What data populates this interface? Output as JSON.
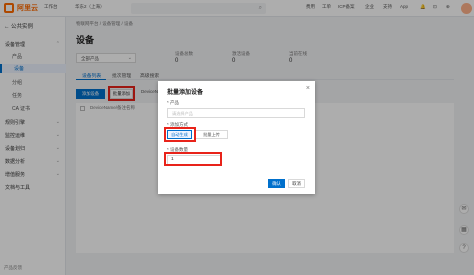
{
  "topbar": {
    "brand": "阿里云",
    "console": "工作台",
    "region": "华东2（上海）",
    "search_placeholder": "",
    "right_items": [
      "费用",
      "工单",
      "ICP备案",
      "企业",
      "支持",
      "App"
    ]
  },
  "sidebar": {
    "back_label": "公共实例",
    "items": [
      {
        "label": "设备管理",
        "level": "top"
      },
      {
        "label": "产品",
        "level": "sub"
      },
      {
        "label": "设备",
        "level": "sub",
        "active": true
      },
      {
        "label": "分组",
        "level": "sub"
      },
      {
        "label": "任务",
        "level": "sub"
      },
      {
        "label": "CA 证书",
        "level": "sub"
      },
      {
        "label": "规则引擎",
        "level": "top"
      },
      {
        "label": "监控运维",
        "level": "top"
      },
      {
        "label": "设备划归",
        "level": "top"
      },
      {
        "label": "数据分析",
        "level": "top"
      },
      {
        "label": "增值服务",
        "level": "top"
      },
      {
        "label": "文档与工具",
        "level": "top"
      }
    ],
    "bottom_label": "产品反馈"
  },
  "main": {
    "breadcrumb": "物联网平台  /  设备管理  /  设备",
    "title": "设备",
    "product_select": "全部产品",
    "stats": [
      {
        "label": "设备总数",
        "value": "0"
      },
      {
        "label": "激活设备",
        "value": "0"
      },
      {
        "label": "当前在线",
        "value": "0"
      }
    ],
    "tabs": [
      "设备列表",
      "批次管理",
      "高级搜索"
    ],
    "add_device_label": "添加设备",
    "batch_add_label": "批量添加",
    "device_filter": "DeviceName",
    "table_header": "DeviceName/备注名称"
  },
  "modal": {
    "title": "批量添加设备",
    "product_label": "* 产品",
    "product_placeholder": "请选择产品",
    "method_label": "* 添加方式",
    "method_auto": "自动生成",
    "method_upload": "批量上传",
    "count_label": "* 设备数量",
    "count_value": "1",
    "ok_label": "确认",
    "cancel_label": "取消",
    "close_icon": "close-icon"
  }
}
